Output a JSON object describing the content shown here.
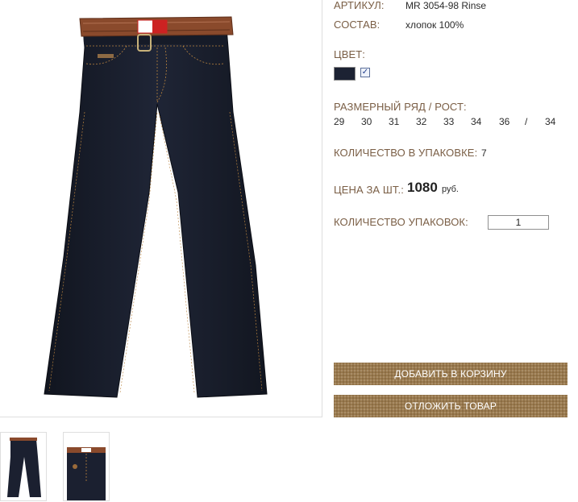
{
  "product": {
    "article_label": "АРТИКУЛ:",
    "article_value": "MR 3054-98 Rinse",
    "composition_label": "СОСТАВ:",
    "composition_value": "хлопок 100%",
    "color_label": "ЦВЕТ:",
    "color_swatch": "#1c2233",
    "size_label": "РАЗМЕРНЫЙ РЯД / РОСТ:",
    "sizes": [
      "29",
      "30",
      "31",
      "32",
      "33",
      "34",
      "36",
      "/",
      "34"
    ],
    "pack_qty_label": "КОЛИЧЕСТВО В УПАКОВКЕ:",
    "pack_qty_value": "7",
    "price_label": "ЦЕНА ЗА ШТ.:",
    "price_value": "1080",
    "price_currency": "руб.",
    "packs_label": "КОЛИЧЕСТВО УПАКОВОК:",
    "packs_value": "1"
  },
  "actions": {
    "add_to_cart": "ДОБАВИТЬ В КОРЗИНУ",
    "defer": "ОТЛОЖИТЬ ТОВАР"
  },
  "colors": {
    "label_brown": "#7a5e45",
    "button_bg": "#9a7a4e",
    "denim": "#1b2030",
    "belt": "#8a4a2c"
  }
}
